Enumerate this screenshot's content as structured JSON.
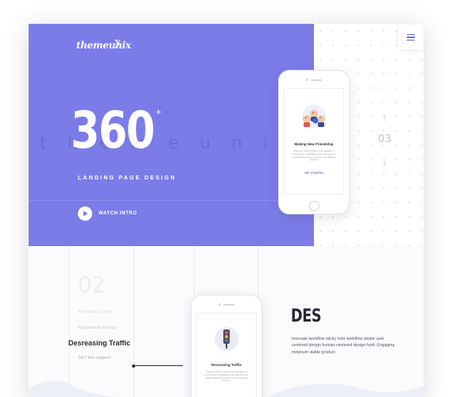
{
  "brand": {
    "logo_text": "themeunix"
  },
  "hero": {
    "big_number": "360",
    "plus": "+",
    "subtitle": "LANDING PAGE DESIGN",
    "watch_label": "WATCH INTRO",
    "ghost_word": "themeunix",
    "accent_color": "#7b7ce8"
  },
  "slider": {
    "up_icon": "arrow-up-icon",
    "current": "03",
    "down_icon": "arrow-down-icon"
  },
  "phone_top": {
    "title": "Making New Friendship",
    "text": "There are many variations of passages of Lorem Ipsum available but the majority have suffered alteration in some form by injected humour.",
    "cta": "GET STARTED"
  },
  "lower": {
    "big_number": "02",
    "menu": [
      {
        "label": "Best web Support",
        "state": "faded"
      },
      {
        "label": "Responsive Design",
        "state": "normal"
      },
      {
        "label": "Desreasing Traffic",
        "state": "active"
      },
      {
        "label": "24/7 live support",
        "state": "mid"
      }
    ],
    "heading": "DES",
    "text": "Innovate workflow sticky note workflow ideate user centered design human-centered design fund. Engaging minimum viable product"
  },
  "phone_bottom": {
    "title": "Decreasing Traffic",
    "text": "There are many variations of passages of Lorem Ipsum available but the majority have suffered alteration in some form by injected humour."
  }
}
